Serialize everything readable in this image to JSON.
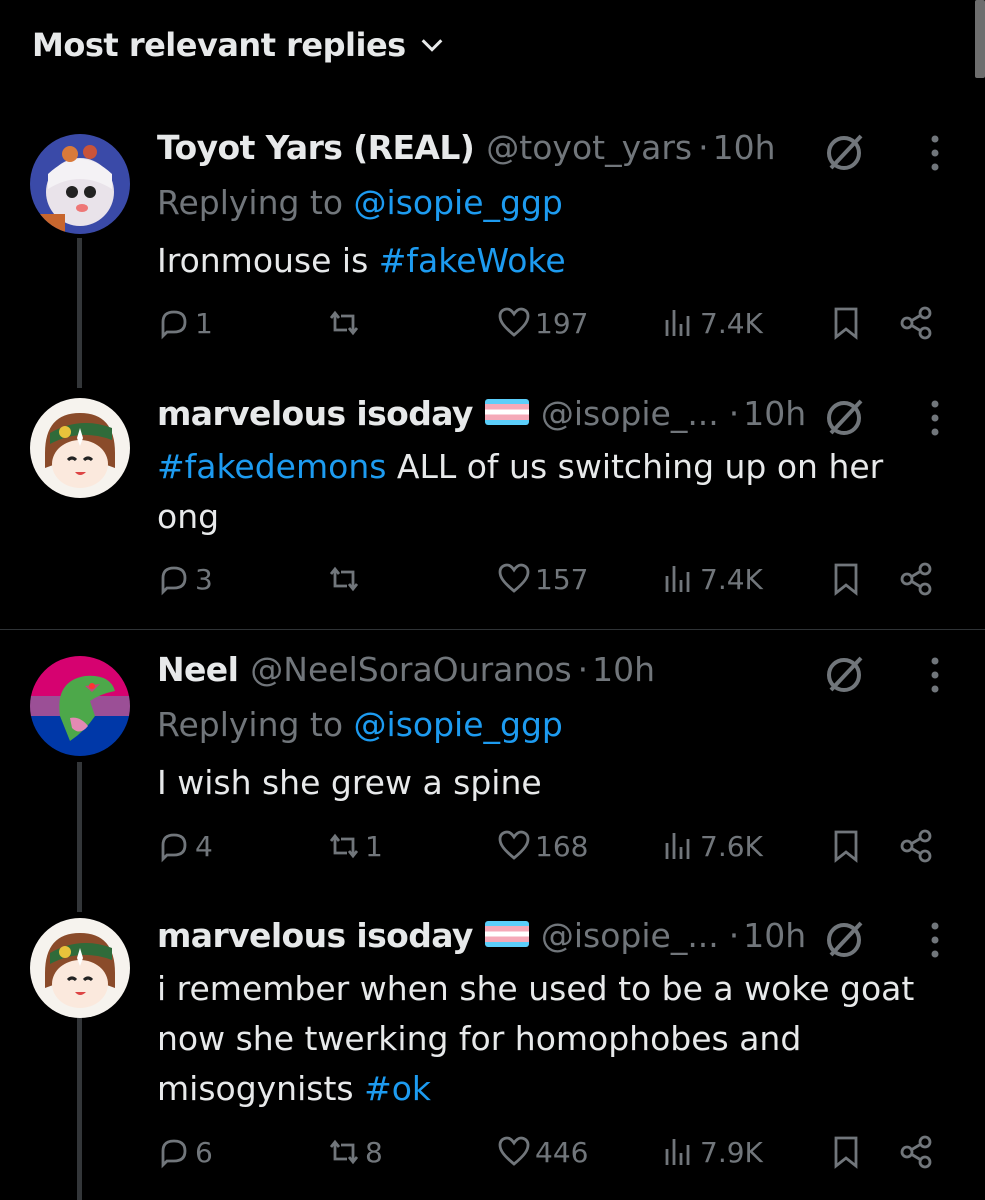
{
  "sort": {
    "label": "Most relevant replies",
    "icon": "chevron-down-icon"
  },
  "colors": {
    "background": "#000000",
    "text": "#e7e9ea",
    "muted": "#71767b",
    "link": "#1d9bf0"
  },
  "replies": [
    {
      "name": "Toyot Yars (REAL)",
      "handle": "@toyot_yars",
      "dot": "·",
      "time": "10h",
      "replying_prefix": "Replying to",
      "replying_to": "@isopie_ggp",
      "text_plain": "Ironmouse is ",
      "text_tag": "#fakeWoke",
      "stats": {
        "replies": "1",
        "reposts": "",
        "likes": "197",
        "views": "7.4K"
      }
    },
    {
      "name": "marvelous isoday",
      "handle": "@isopie_...",
      "dot": "·",
      "time": "10h",
      "text_tag": "#fakedemons",
      "text_plain": " ALL of us switching up on her ong",
      "stats": {
        "replies": "3",
        "reposts": "",
        "likes": "157",
        "views": "7.4K"
      }
    },
    {
      "name": "Neel",
      "handle": "@NeelSoraOuranos",
      "dot": "·",
      "time": "10h",
      "replying_prefix": "Replying to",
      "replying_to": "@isopie_ggp",
      "text_plain": "I wish she grew a spine",
      "stats": {
        "replies": "4",
        "reposts": "1",
        "likes": "168",
        "views": "7.6K"
      }
    },
    {
      "name": "marvelous isoday",
      "handle": "@isopie_...",
      "dot": "·",
      "time": "10h",
      "text_plain": "i remember when she used to be a woke goat now she twerking for homophobes and misogynists ",
      "text_tag": "#ok",
      "stats": {
        "replies": "6",
        "reposts": "8",
        "likes": "446",
        "views": "7.9K"
      }
    }
  ]
}
